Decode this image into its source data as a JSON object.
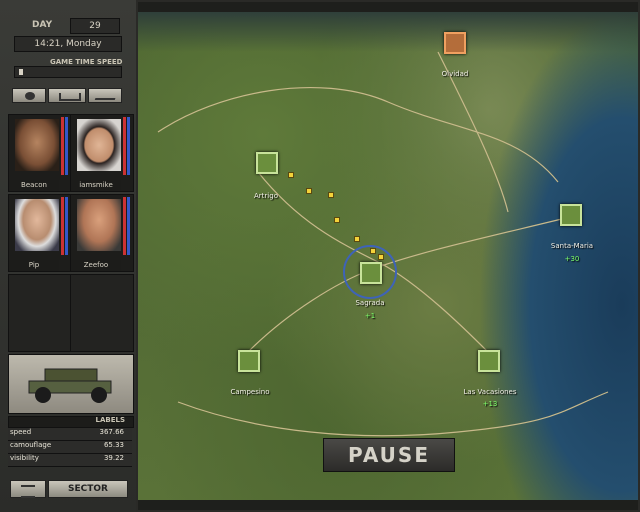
{
  "time": {
    "day_label": "DAY",
    "day_value": "29",
    "clock": "14:21, Monday",
    "speed_label": "GAME TIME SPEED"
  },
  "squad": [
    {
      "name": "Beacon"
    },
    {
      "name": "iamsmike"
    },
    {
      "name": "Pip"
    },
    {
      "name": "Zeefoo"
    }
  ],
  "vehicle": {
    "labels_title": "LABELS",
    "stats": [
      {
        "label": "speed",
        "value": "367.66"
      },
      {
        "label": "camouflage",
        "value": "65.33"
      },
      {
        "label": "visibility",
        "value": "39.22"
      }
    ]
  },
  "bottom": {
    "sector_label": "SECTOR"
  },
  "map": {
    "pause_label": "PAUSE",
    "towns": [
      {
        "name": "Olvidad",
        "value": ""
      },
      {
        "name": "Artrigo",
        "value": ""
      },
      {
        "name": "Santa-Maria",
        "value": "+30"
      },
      {
        "name": "Sagrada",
        "value": "+1"
      },
      {
        "name": "Campesino",
        "value": ""
      },
      {
        "name": "Las Vacasiones",
        "value": "+13"
      }
    ]
  }
}
